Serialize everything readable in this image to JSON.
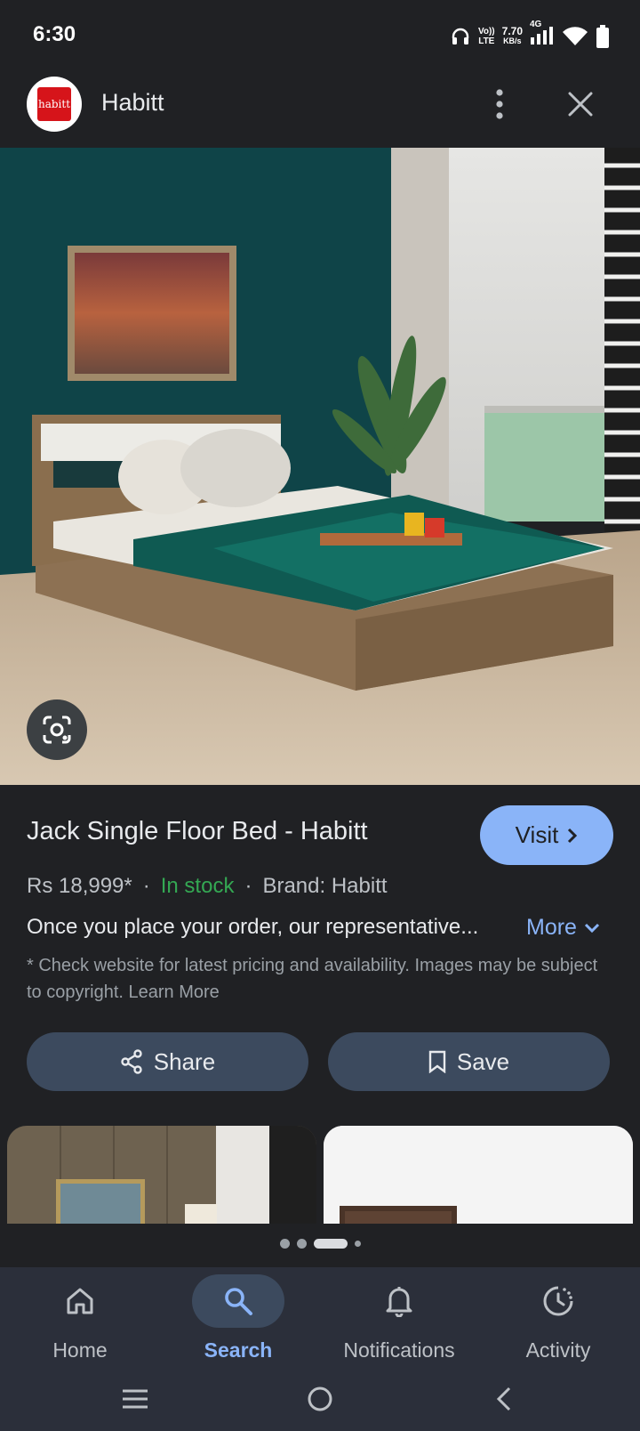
{
  "status": {
    "time": "6:30",
    "volte_top": "Vo))",
    "volte_bottom": "LTE",
    "speed_value": "7.70",
    "speed_unit": "KB/s",
    "network": "4G",
    "icons": [
      "headphones-icon",
      "signal-icon",
      "wifi-icon",
      "battery-icon"
    ]
  },
  "header": {
    "logo_text": "habitt",
    "site_name": "Habitt",
    "icons": [
      "more-vert-icon",
      "close-icon"
    ]
  },
  "product": {
    "title": "Jack Single Floor Bed - Habitt",
    "visit_label": "Visit",
    "price": "Rs 18,999*",
    "stock": "In stock",
    "brand": "Brand: Habitt",
    "separator": "·",
    "description": "Once you place your order, our representative...",
    "more_label": "More",
    "disclaimer": "* Check website for latest pricing and availability. Images may be subject to copyright. Learn More"
  },
  "actions": {
    "share_label": "Share",
    "save_label": "Save"
  },
  "nav": {
    "items": [
      {
        "label": "Home",
        "icon": "home-icon"
      },
      {
        "label": "Search",
        "icon": "search-icon",
        "active": true
      },
      {
        "label": "Notifications",
        "icon": "bell-icon"
      },
      {
        "label": "Activity",
        "icon": "activity-icon"
      }
    ]
  },
  "colors": {
    "accent": "#8ab4f8",
    "in_stock": "#34a853",
    "background": "#202124",
    "pill": "#3c4a5e"
  }
}
